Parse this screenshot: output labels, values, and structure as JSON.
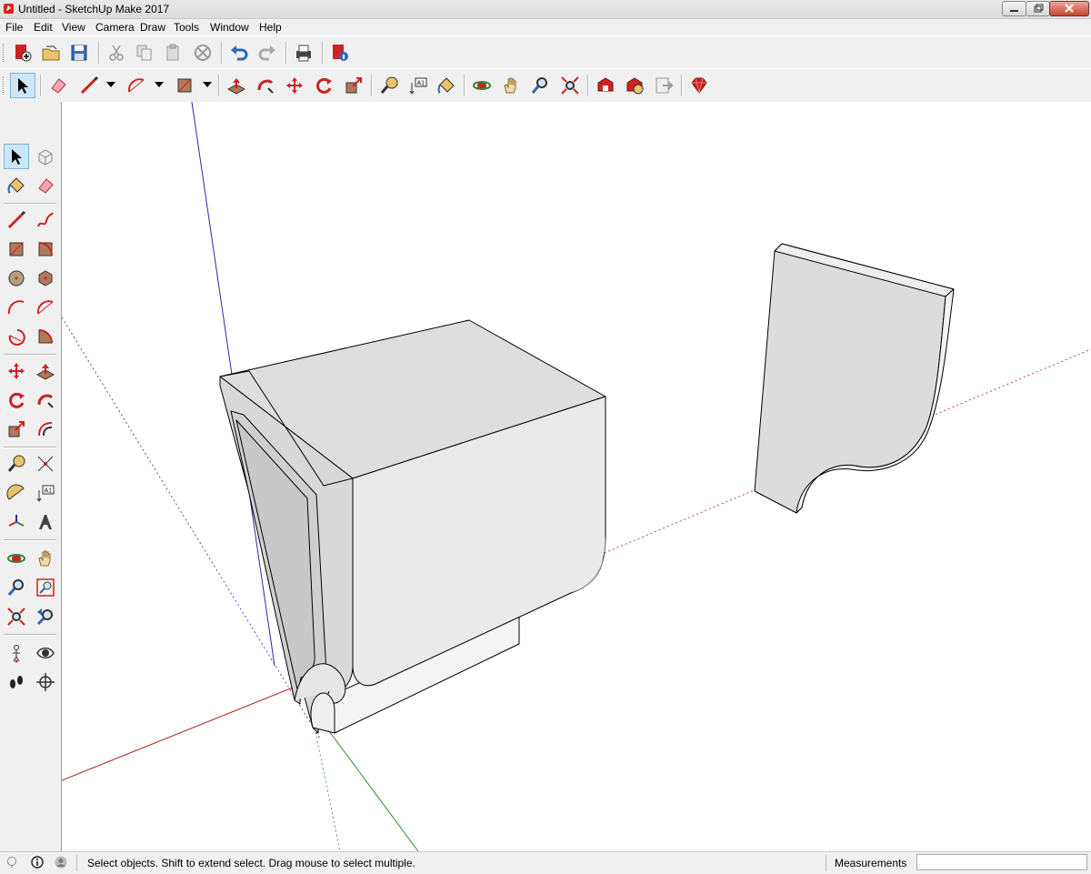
{
  "window": {
    "title": "Untitled - SketchUp Make 2017"
  },
  "menu": {
    "items": [
      "File",
      "Edit",
      "View",
      "Camera",
      "Draw",
      "Tools",
      "Window",
      "Help"
    ]
  },
  "toolbar1": {
    "icons": [
      "new-model-icon",
      "open-icon",
      "save-icon",
      "cut-icon",
      "copy-icon",
      "paste-icon",
      "erase-icon",
      "undo-icon",
      "redo-icon",
      "print-icon",
      "model-info-icon"
    ]
  },
  "toolbar2": {
    "icons": [
      "select-icon",
      "eraser-icon",
      "line-icon",
      "arc-icon",
      "rectangle-icon",
      "push-pull-icon",
      "follow-me-icon",
      "move-icon",
      "rotate-icon",
      "scale-icon",
      "tape-measure-icon",
      "text-icon",
      "paint-bucket-icon",
      "orbit-icon",
      "pan-icon",
      "zoom-icon",
      "zoom-extents-icon",
      "warehouse-icon",
      "extension-warehouse-icon",
      "layout-icon",
      "ruby-icon"
    ]
  },
  "statusbar": {
    "message": "Select objects. Shift to extend select. Drag mouse to select multiple.",
    "measurements_label": "Measurements",
    "measurements_value": ""
  },
  "colors": {
    "x_axis": "#b22222",
    "y_axis": "#2e8b2e",
    "z_axis": "#2a2aa8",
    "face": "#e0e0e0",
    "face_dark": "#cfcfcf",
    "selection": "#cde6f7"
  }
}
